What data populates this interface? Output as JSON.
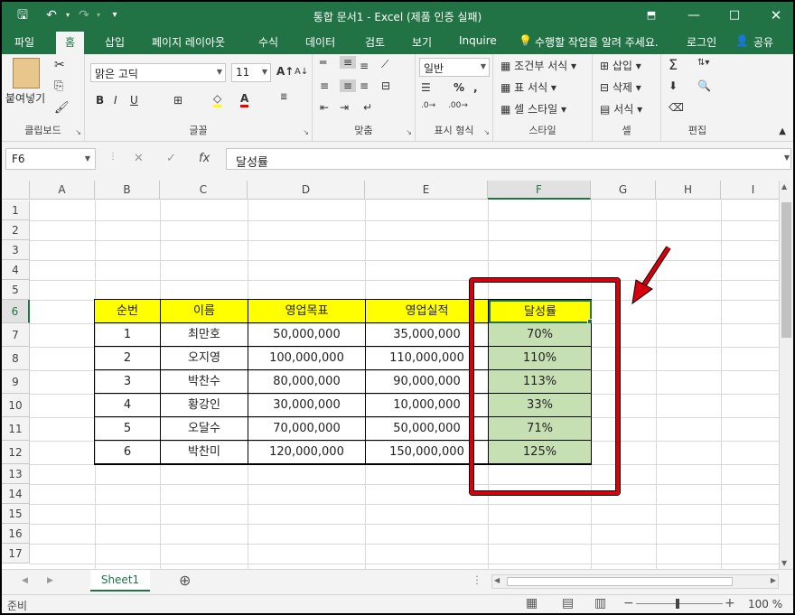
{
  "window": {
    "title": "통합 문서1 - Excel (제품 인증 실패)"
  },
  "ribbon_tabs": [
    "파일",
    "홈",
    "삽입",
    "페이지 레이아웃",
    "수식",
    "데이터",
    "검토",
    "보기",
    "Inquire"
  ],
  "tell_me": "수행할 작업을 알려 주세요.",
  "login": "로그인",
  "share": "공유",
  "ribbon": {
    "clipboard": {
      "paste": "붙여넣기",
      "label": "클립보드"
    },
    "font": {
      "name": "맑은 고딕",
      "size": "11",
      "label": "글꼴"
    },
    "align": {
      "label": "맞춤"
    },
    "number": {
      "format": "일반",
      "label": "표시 형식"
    },
    "styles": {
      "conditional": "조건부 서식",
      "table": "표 서식",
      "cell": "셀 스타일",
      "label": "스타일"
    },
    "cells": {
      "insert": "삽입",
      "delete": "삭제",
      "format": "서식",
      "label": "셀"
    },
    "editing": {
      "label": "편집"
    }
  },
  "formula_bar": {
    "name_box": "F6",
    "content": "달성률"
  },
  "columns": [
    "A",
    "B",
    "C",
    "D",
    "E",
    "F",
    "G",
    "H",
    "I"
  ],
  "rows": [
    "1",
    "2",
    "3",
    "4",
    "5",
    "6",
    "7",
    "8",
    "9",
    "10",
    "11",
    "12",
    "13",
    "14",
    "15",
    "16",
    "17"
  ],
  "table": {
    "headers": [
      "순번",
      "이름",
      "영업목표",
      "영업실적",
      "달성률"
    ],
    "rows": [
      [
        "1",
        "최만호",
        "50,000,000",
        "35,000,000",
        "70%"
      ],
      [
        "2",
        "오지영",
        "100,000,000",
        "110,000,000",
        "110%"
      ],
      [
        "3",
        "박찬수",
        "80,000,000",
        "90,000,000",
        "113%"
      ],
      [
        "4",
        "황강인",
        "30,000,000",
        "10,000,000",
        "33%"
      ],
      [
        "5",
        "오달수",
        "70,000,000",
        "50,000,000",
        "71%"
      ],
      [
        "6",
        "박찬미",
        "120,000,000",
        "150,000,000",
        "125%"
      ]
    ]
  },
  "sheet_tab": "Sheet1",
  "status": {
    "mode": "준비",
    "zoom": "100 %"
  },
  "colors": {
    "excel_green": "#217346",
    "header_fill": "#ffff00",
    "result_fill": "#c6e0b4",
    "annotation": "#d9000d"
  }
}
